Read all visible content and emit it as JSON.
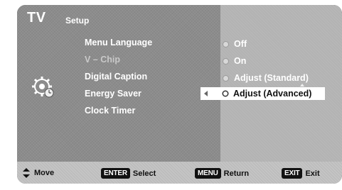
{
  "header": {
    "app_title": "TV",
    "section_title": "Setup"
  },
  "menu": {
    "items": [
      {
        "label": "Menu Language",
        "state": "normal"
      },
      {
        "label": "V – Chip",
        "state": "dimmed"
      },
      {
        "label": "Digital Caption",
        "state": "normal"
      },
      {
        "label": "Energy Saver",
        "state": "normal"
      },
      {
        "label": "Clock Timer",
        "state": "normal"
      }
    ]
  },
  "options": {
    "items": [
      {
        "label": "Off",
        "selected": false
      },
      {
        "label": "On",
        "selected": false
      },
      {
        "label": "Adjust (Standard)",
        "selected": false
      },
      {
        "label": "Adjust (Advanced)",
        "selected": true
      }
    ]
  },
  "footer": {
    "move_label": "Move",
    "enter_key": "ENTER",
    "enter_label": "Select",
    "menu_key": "MENU",
    "menu_label": "Return",
    "exit_key": "EXIT",
    "exit_label": "Exit"
  },
  "icons": {
    "settings": "gear-icon",
    "move": "up-down-arrows-icon"
  },
  "colors": {
    "menu_background": "#8c8c8c",
    "options_background": "#b3b3b3",
    "footer_background": "#c4c4c4",
    "highlight": "#ffffff"
  }
}
